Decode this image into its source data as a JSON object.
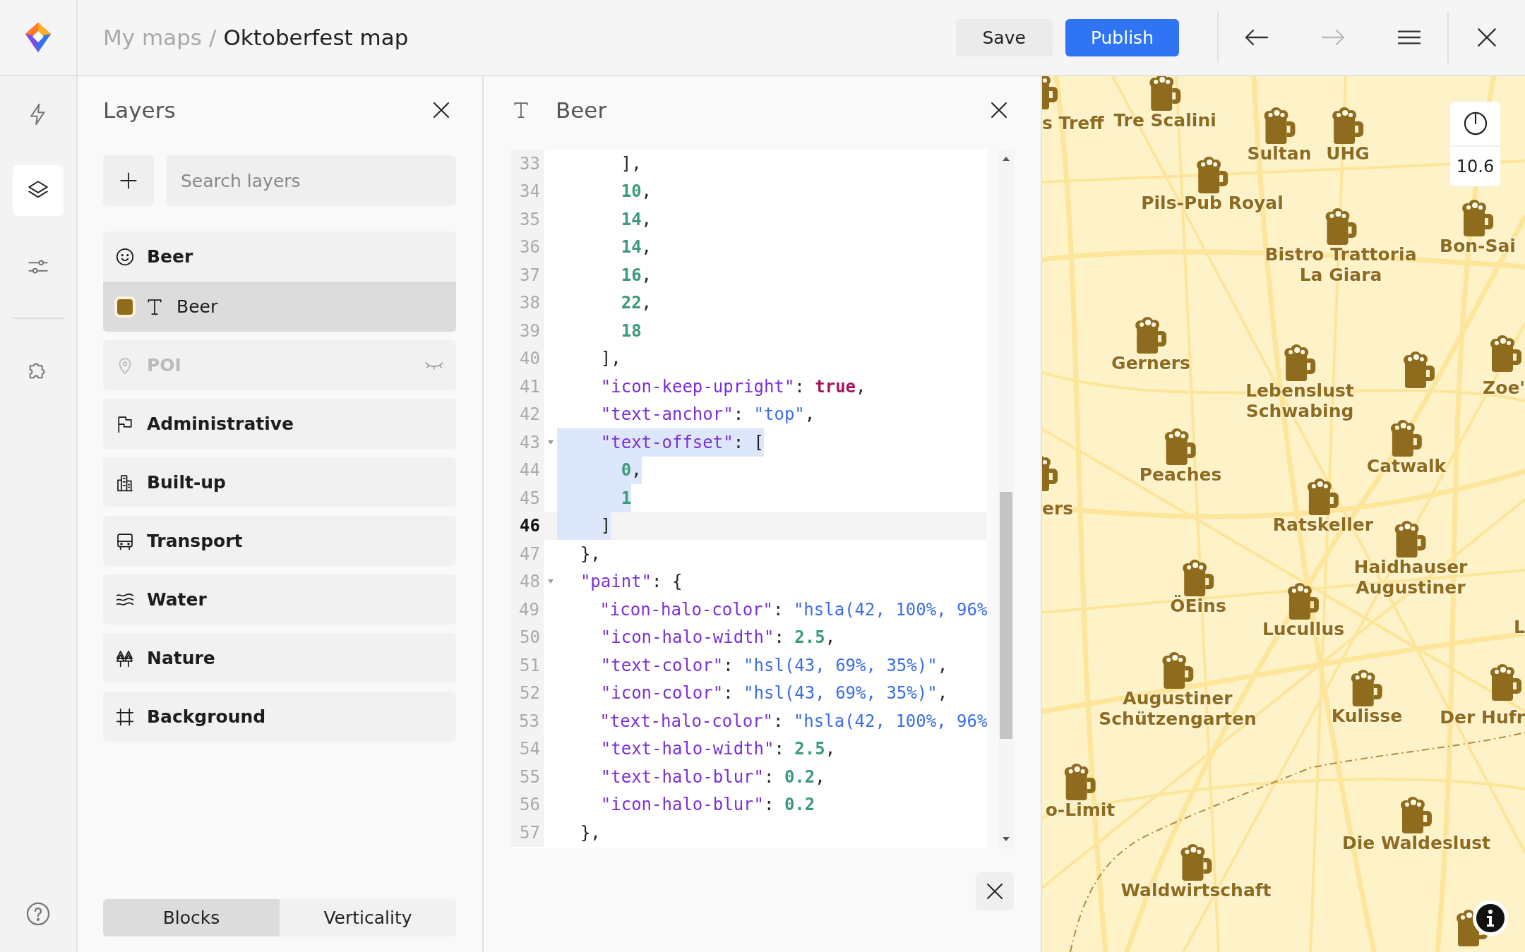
{
  "topbar": {
    "breadcrumb_parent": "My maps",
    "separator": "/",
    "title": "Oktoberfest map",
    "save": "Save",
    "publish": "Publish",
    "back_disabled": false,
    "forward_disabled": true
  },
  "rail": [
    {
      "selected": false
    },
    {
      "selected": true
    },
    {
      "selected": false
    },
    {
      "selected": false
    }
  ],
  "layers": {
    "title": "Layers",
    "search": {
      "placeholder": "Search layers"
    },
    "items": [
      {
        "label": "Beer",
        "hidden": false,
        "selected": false,
        "children": [
          {
            "label": "Beer",
            "selected": true,
            "color": "#8f6b1d"
          }
        ]
      },
      {
        "label": "POI",
        "hidden": true,
        "selected": false
      },
      {
        "label": "Administrative",
        "hidden": false,
        "selected": false
      },
      {
        "label": "Built-up",
        "hidden": false,
        "selected": false
      },
      {
        "label": "Transport",
        "hidden": false,
        "selected": false
      },
      {
        "label": "Water",
        "hidden": false,
        "selected": false
      },
      {
        "label": "Nature",
        "hidden": false,
        "selected": false
      },
      {
        "label": "Background",
        "hidden": false,
        "selected": false
      }
    ],
    "tabs": [
      {
        "label": "Blocks",
        "selected": true
      },
      {
        "label": "Verticality",
        "selected": false
      }
    ]
  },
  "editor": {
    "title": "Beer",
    "lines": [
      {
        "number": "33",
        "foldable": false,
        "selected": false,
        "current": false,
        "segments": [
          {
            "kind": "punct",
            "text": "      ],"
          }
        ]
      },
      {
        "number": "34",
        "foldable": false,
        "selected": false,
        "current": false,
        "segments": [
          {
            "kind": "number",
            "text": "      10"
          },
          {
            "kind": "punct",
            "text": ","
          }
        ]
      },
      {
        "number": "35",
        "foldable": false,
        "selected": false,
        "current": false,
        "segments": [
          {
            "kind": "number",
            "text": "      14"
          },
          {
            "kind": "punct",
            "text": ","
          }
        ]
      },
      {
        "number": "36",
        "foldable": false,
        "selected": false,
        "current": false,
        "segments": [
          {
            "kind": "number",
            "text": "      14"
          },
          {
            "kind": "punct",
            "text": ","
          }
        ]
      },
      {
        "number": "37",
        "foldable": false,
        "selected": false,
        "current": false,
        "segments": [
          {
            "kind": "number",
            "text": "      16"
          },
          {
            "kind": "punct",
            "text": ","
          }
        ]
      },
      {
        "number": "38",
        "foldable": false,
        "selected": false,
        "current": false,
        "segments": [
          {
            "kind": "number",
            "text": "      22"
          },
          {
            "kind": "punct",
            "text": ","
          }
        ]
      },
      {
        "number": "39",
        "foldable": false,
        "selected": false,
        "current": false,
        "segments": [
          {
            "kind": "number",
            "text": "      18"
          }
        ]
      },
      {
        "number": "40",
        "foldable": false,
        "selected": false,
        "current": false,
        "segments": [
          {
            "kind": "punct",
            "text": "    ],"
          }
        ]
      },
      {
        "number": "41",
        "foldable": false,
        "selected": false,
        "current": false,
        "segments": [
          {
            "kind": "key",
            "text": "    \"icon-keep-upright\""
          },
          {
            "kind": "punct",
            "text": ": "
          },
          {
            "kind": "bool",
            "text": "true"
          },
          {
            "kind": "punct",
            "text": ","
          }
        ]
      },
      {
        "number": "42",
        "foldable": false,
        "selected": false,
        "current": false,
        "segments": [
          {
            "kind": "key",
            "text": "    \"text-anchor\""
          },
          {
            "kind": "punct",
            "text": ": "
          },
          {
            "kind": "string",
            "text": "\"top\""
          },
          {
            "kind": "punct",
            "text": ","
          }
        ]
      },
      {
        "number": "43",
        "foldable": true,
        "selected": true,
        "current": false,
        "segments": [
          {
            "kind": "key",
            "text": "    \"text-offset\""
          },
          {
            "kind": "punct",
            "text": ": ["
          }
        ]
      },
      {
        "number": "44",
        "foldable": false,
        "selected": true,
        "current": false,
        "segments": [
          {
            "kind": "number",
            "text": "      0"
          },
          {
            "kind": "punct",
            "text": ","
          }
        ]
      },
      {
        "number": "45",
        "foldable": false,
        "selected": true,
        "current": false,
        "segments": [
          {
            "kind": "number",
            "text": "      1"
          }
        ]
      },
      {
        "number": "46",
        "foldable": false,
        "selected": true,
        "current": true,
        "segments": [
          {
            "kind": "punct",
            "text": "    ]"
          }
        ]
      },
      {
        "number": "47",
        "foldable": false,
        "selected": false,
        "current": false,
        "segments": [
          {
            "kind": "punct",
            "text": "  },"
          }
        ]
      },
      {
        "number": "48",
        "foldable": true,
        "selected": false,
        "current": false,
        "segments": [
          {
            "kind": "key",
            "text": "  \"paint\""
          },
          {
            "kind": "punct",
            "text": ": {"
          }
        ]
      },
      {
        "number": "49",
        "foldable": false,
        "selected": false,
        "current": false,
        "segments": [
          {
            "kind": "key",
            "text": "    \"icon-halo-color\""
          },
          {
            "kind": "punct",
            "text": ": "
          },
          {
            "kind": "string",
            "text": "\"hsla(42, 100%, 96%"
          }
        ]
      },
      {
        "number": "50",
        "foldable": false,
        "selected": false,
        "current": false,
        "segments": [
          {
            "kind": "key",
            "text": "    \"icon-halo-width\""
          },
          {
            "kind": "punct",
            "text": ": "
          },
          {
            "kind": "number",
            "text": "2.5"
          },
          {
            "kind": "punct",
            "text": ","
          }
        ]
      },
      {
        "number": "51",
        "foldable": false,
        "selected": false,
        "current": false,
        "segments": [
          {
            "kind": "key",
            "text": "    \"text-color\""
          },
          {
            "kind": "punct",
            "text": ": "
          },
          {
            "kind": "string",
            "text": "\"hsl(43, 69%, 35%)\""
          },
          {
            "kind": "punct",
            "text": ","
          }
        ]
      },
      {
        "number": "52",
        "foldable": false,
        "selected": false,
        "current": false,
        "segments": [
          {
            "kind": "key",
            "text": "    \"icon-color\""
          },
          {
            "kind": "punct",
            "text": ": "
          },
          {
            "kind": "string",
            "text": "\"hsl(43, 69%, 35%)\""
          },
          {
            "kind": "punct",
            "text": ","
          }
        ]
      },
      {
        "number": "53",
        "foldable": false,
        "selected": false,
        "current": false,
        "segments": [
          {
            "kind": "key",
            "text": "    \"text-halo-color\""
          },
          {
            "kind": "punct",
            "text": ": "
          },
          {
            "kind": "string",
            "text": "\"hsla(42, 100%, 96%"
          }
        ]
      },
      {
        "number": "54",
        "foldable": false,
        "selected": false,
        "current": false,
        "segments": [
          {
            "kind": "key",
            "text": "    \"text-halo-width\""
          },
          {
            "kind": "punct",
            "text": ": "
          },
          {
            "kind": "number",
            "text": "2.5"
          },
          {
            "kind": "punct",
            "text": ","
          }
        ]
      },
      {
        "number": "55",
        "foldable": false,
        "selected": false,
        "current": false,
        "segments": [
          {
            "kind": "key",
            "text": "    \"text-halo-blur\""
          },
          {
            "kind": "punct",
            "text": ": "
          },
          {
            "kind": "number",
            "text": "0.2"
          },
          {
            "kind": "punct",
            "text": ","
          }
        ]
      },
      {
        "number": "56",
        "foldable": false,
        "selected": false,
        "current": false,
        "segments": [
          {
            "kind": "key",
            "text": "    \"icon-halo-blur\""
          },
          {
            "kind": "punct",
            "text": ": "
          },
          {
            "kind": "number",
            "text": "0.2"
          }
        ]
      },
      {
        "number": "57",
        "foldable": false,
        "selected": false,
        "current": false,
        "segments": [
          {
            "kind": "punct",
            "text": "  },"
          }
        ]
      }
    ]
  },
  "map": {
    "zoom": "10.6",
    "labels": [
      "s Treff",
      "Tre Scalini",
      "Sultan",
      "UHG",
      "Pils-Pub Royal",
      "Bistro Trattoria\nLa Giara",
      "Bon-Sai",
      "Gerners",
      "Lebenslust\nSchwabing",
      "Zoe'",
      "Peaches",
      "ers",
      "Catwalk",
      "Ratskeller",
      "Haidhauser\nAugustiner",
      "ÖEins",
      "Lucullus",
      "L",
      "Augustiner\nSchützengarten",
      "Kulisse",
      "Der Hufr",
      "o-Limit",
      "Die Waldeslust",
      "Waldwirtschaft"
    ]
  }
}
